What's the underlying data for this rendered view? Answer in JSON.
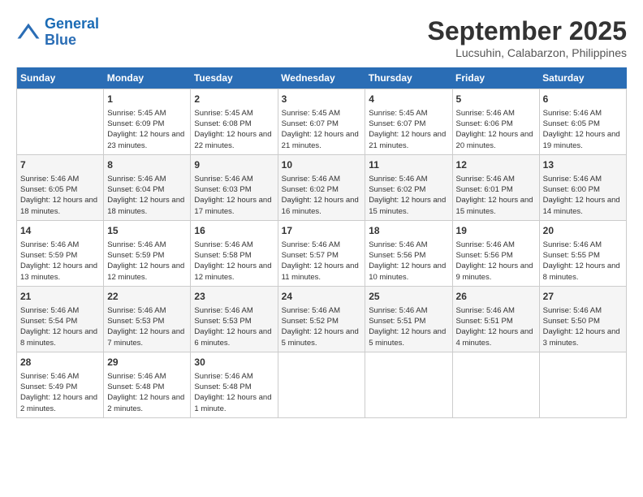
{
  "logo": {
    "line1": "General",
    "line2": "Blue"
  },
  "title": "September 2025",
  "location": "Lucsuhin, Calabarzon, Philippines",
  "weekdays": [
    "Sunday",
    "Monday",
    "Tuesday",
    "Wednesday",
    "Thursday",
    "Friday",
    "Saturday"
  ],
  "weeks": [
    [
      {
        "day": "",
        "sunrise": "",
        "sunset": "",
        "daylight": ""
      },
      {
        "day": "1",
        "sunrise": "Sunrise: 5:45 AM",
        "sunset": "Sunset: 6:09 PM",
        "daylight": "Daylight: 12 hours and 23 minutes."
      },
      {
        "day": "2",
        "sunrise": "Sunrise: 5:45 AM",
        "sunset": "Sunset: 6:08 PM",
        "daylight": "Daylight: 12 hours and 22 minutes."
      },
      {
        "day": "3",
        "sunrise": "Sunrise: 5:45 AM",
        "sunset": "Sunset: 6:07 PM",
        "daylight": "Daylight: 12 hours and 21 minutes."
      },
      {
        "day": "4",
        "sunrise": "Sunrise: 5:45 AM",
        "sunset": "Sunset: 6:07 PM",
        "daylight": "Daylight: 12 hours and 21 minutes."
      },
      {
        "day": "5",
        "sunrise": "Sunrise: 5:46 AM",
        "sunset": "Sunset: 6:06 PM",
        "daylight": "Daylight: 12 hours and 20 minutes."
      },
      {
        "day": "6",
        "sunrise": "Sunrise: 5:46 AM",
        "sunset": "Sunset: 6:05 PM",
        "daylight": "Daylight: 12 hours and 19 minutes."
      }
    ],
    [
      {
        "day": "7",
        "sunrise": "Sunrise: 5:46 AM",
        "sunset": "Sunset: 6:05 PM",
        "daylight": "Daylight: 12 hours and 18 minutes."
      },
      {
        "day": "8",
        "sunrise": "Sunrise: 5:46 AM",
        "sunset": "Sunset: 6:04 PM",
        "daylight": "Daylight: 12 hours and 18 minutes."
      },
      {
        "day": "9",
        "sunrise": "Sunrise: 5:46 AM",
        "sunset": "Sunset: 6:03 PM",
        "daylight": "Daylight: 12 hours and 17 minutes."
      },
      {
        "day": "10",
        "sunrise": "Sunrise: 5:46 AM",
        "sunset": "Sunset: 6:02 PM",
        "daylight": "Daylight: 12 hours and 16 minutes."
      },
      {
        "day": "11",
        "sunrise": "Sunrise: 5:46 AM",
        "sunset": "Sunset: 6:02 PM",
        "daylight": "Daylight: 12 hours and 15 minutes."
      },
      {
        "day": "12",
        "sunrise": "Sunrise: 5:46 AM",
        "sunset": "Sunset: 6:01 PM",
        "daylight": "Daylight: 12 hours and 15 minutes."
      },
      {
        "day": "13",
        "sunrise": "Sunrise: 5:46 AM",
        "sunset": "Sunset: 6:00 PM",
        "daylight": "Daylight: 12 hours and 14 minutes."
      }
    ],
    [
      {
        "day": "14",
        "sunrise": "Sunrise: 5:46 AM",
        "sunset": "Sunset: 5:59 PM",
        "daylight": "Daylight: 12 hours and 13 minutes."
      },
      {
        "day": "15",
        "sunrise": "Sunrise: 5:46 AM",
        "sunset": "Sunset: 5:59 PM",
        "daylight": "Daylight: 12 hours and 12 minutes."
      },
      {
        "day": "16",
        "sunrise": "Sunrise: 5:46 AM",
        "sunset": "Sunset: 5:58 PM",
        "daylight": "Daylight: 12 hours and 12 minutes."
      },
      {
        "day": "17",
        "sunrise": "Sunrise: 5:46 AM",
        "sunset": "Sunset: 5:57 PM",
        "daylight": "Daylight: 12 hours and 11 minutes."
      },
      {
        "day": "18",
        "sunrise": "Sunrise: 5:46 AM",
        "sunset": "Sunset: 5:56 PM",
        "daylight": "Daylight: 12 hours and 10 minutes."
      },
      {
        "day": "19",
        "sunrise": "Sunrise: 5:46 AM",
        "sunset": "Sunset: 5:56 PM",
        "daylight": "Daylight: 12 hours and 9 minutes."
      },
      {
        "day": "20",
        "sunrise": "Sunrise: 5:46 AM",
        "sunset": "Sunset: 5:55 PM",
        "daylight": "Daylight: 12 hours and 8 minutes."
      }
    ],
    [
      {
        "day": "21",
        "sunrise": "Sunrise: 5:46 AM",
        "sunset": "Sunset: 5:54 PM",
        "daylight": "Daylight: 12 hours and 8 minutes."
      },
      {
        "day": "22",
        "sunrise": "Sunrise: 5:46 AM",
        "sunset": "Sunset: 5:53 PM",
        "daylight": "Daylight: 12 hours and 7 minutes."
      },
      {
        "day": "23",
        "sunrise": "Sunrise: 5:46 AM",
        "sunset": "Sunset: 5:53 PM",
        "daylight": "Daylight: 12 hours and 6 minutes."
      },
      {
        "day": "24",
        "sunrise": "Sunrise: 5:46 AM",
        "sunset": "Sunset: 5:52 PM",
        "daylight": "Daylight: 12 hours and 5 minutes."
      },
      {
        "day": "25",
        "sunrise": "Sunrise: 5:46 AM",
        "sunset": "Sunset: 5:51 PM",
        "daylight": "Daylight: 12 hours and 5 minutes."
      },
      {
        "day": "26",
        "sunrise": "Sunrise: 5:46 AM",
        "sunset": "Sunset: 5:51 PM",
        "daylight": "Daylight: 12 hours and 4 minutes."
      },
      {
        "day": "27",
        "sunrise": "Sunrise: 5:46 AM",
        "sunset": "Sunset: 5:50 PM",
        "daylight": "Daylight: 12 hours and 3 minutes."
      }
    ],
    [
      {
        "day": "28",
        "sunrise": "Sunrise: 5:46 AM",
        "sunset": "Sunset: 5:49 PM",
        "daylight": "Daylight: 12 hours and 2 minutes."
      },
      {
        "day": "29",
        "sunrise": "Sunrise: 5:46 AM",
        "sunset": "Sunset: 5:48 PM",
        "daylight": "Daylight: 12 hours and 2 minutes."
      },
      {
        "day": "30",
        "sunrise": "Sunrise: 5:46 AM",
        "sunset": "Sunset: 5:48 PM",
        "daylight": "Daylight: 12 hours and 1 minute."
      },
      {
        "day": "",
        "sunrise": "",
        "sunset": "",
        "daylight": ""
      },
      {
        "day": "",
        "sunrise": "",
        "sunset": "",
        "daylight": ""
      },
      {
        "day": "",
        "sunrise": "",
        "sunset": "",
        "daylight": ""
      },
      {
        "day": "",
        "sunrise": "",
        "sunset": "",
        "daylight": ""
      }
    ]
  ]
}
